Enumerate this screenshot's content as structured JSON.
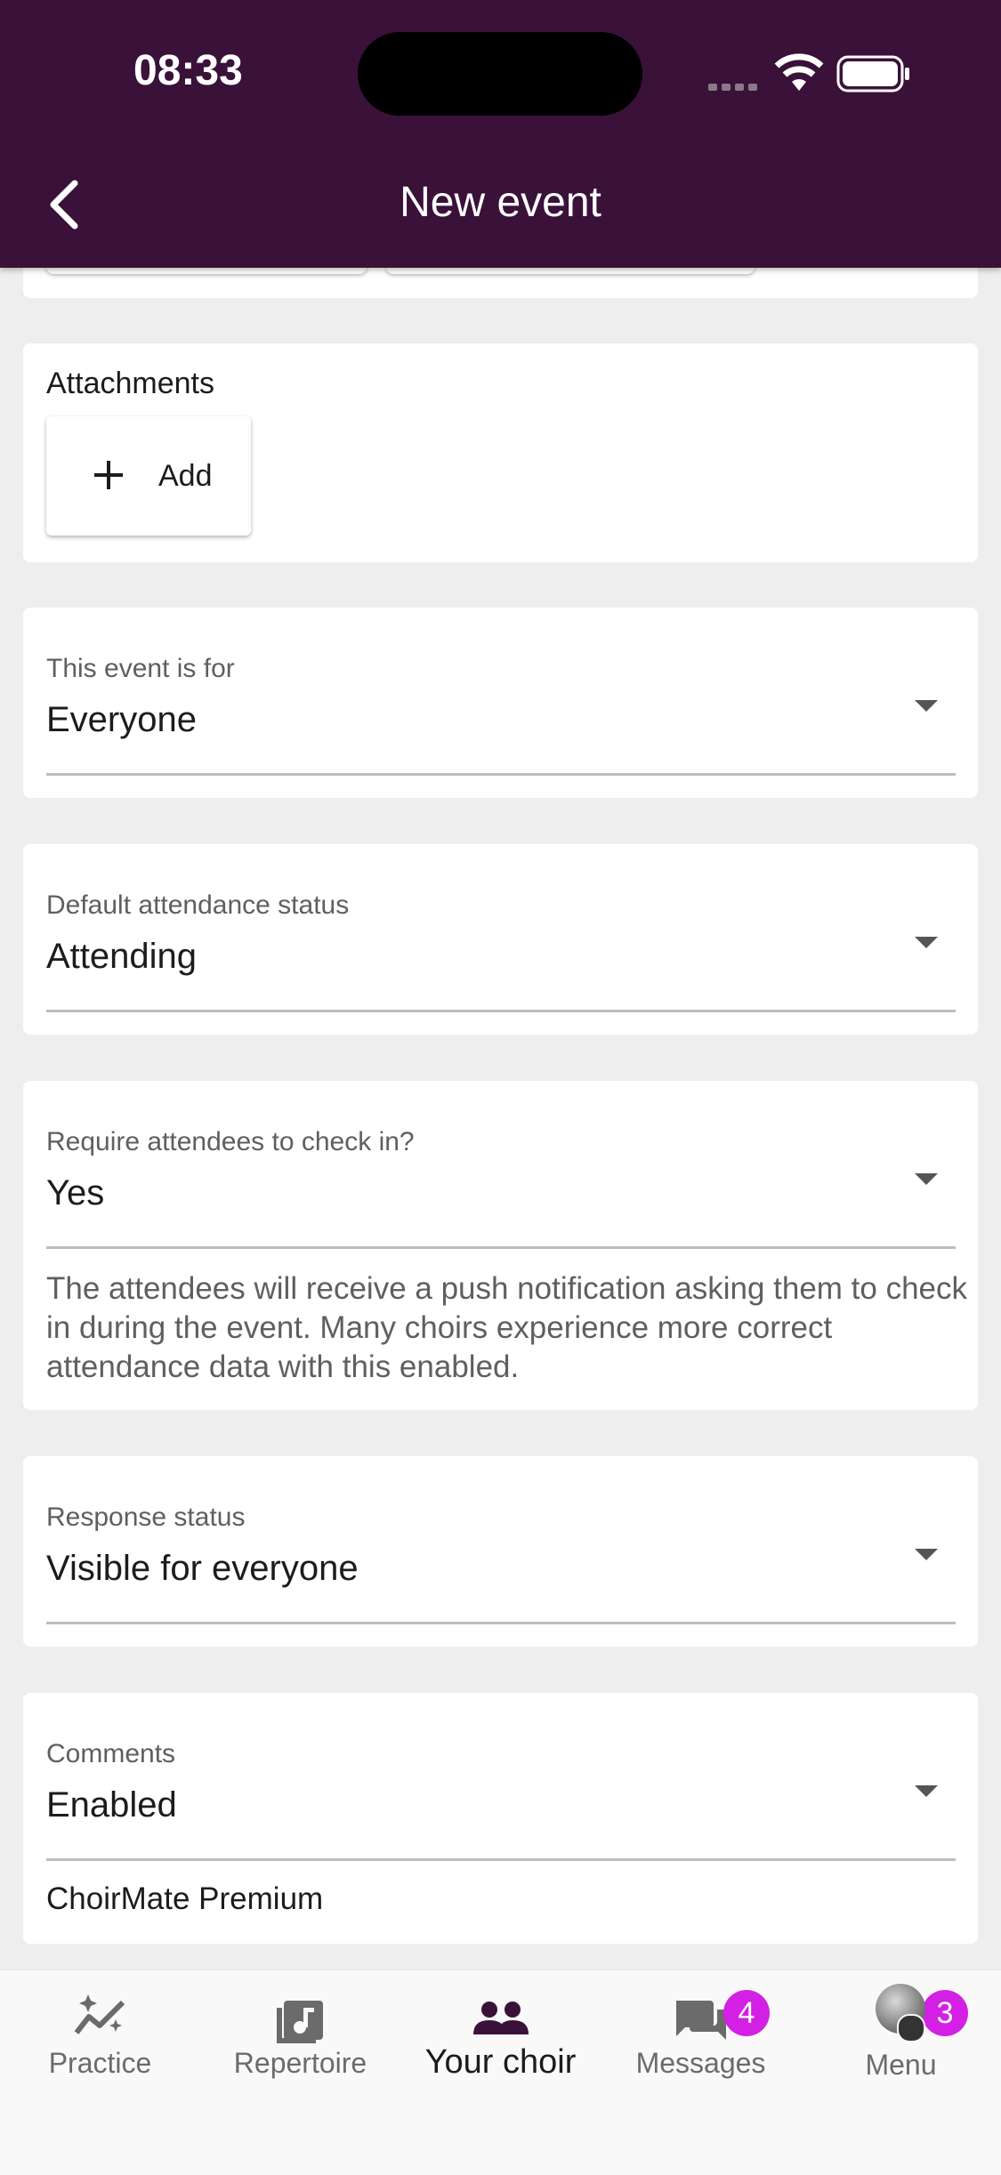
{
  "status_bar": {
    "time": "08:33"
  },
  "header": {
    "title": "New event"
  },
  "attachments": {
    "label": "Attachments",
    "add_label": "Add"
  },
  "event_for": {
    "label": "This event is for",
    "value": "Everyone"
  },
  "default_attendance": {
    "label": "Default attendance status",
    "value": "Attending"
  },
  "check_in": {
    "label": "Require attendees to check in?",
    "value": "Yes",
    "helper": "The attendees will receive a push notification asking them to check in during the event. Many choirs experience more correct attendance data with this enabled."
  },
  "response_status": {
    "label": "Response status",
    "value": "Visible for everyone"
  },
  "comments": {
    "label": "Comments",
    "value": "Enabled",
    "premium_note": "ChoirMate Premium"
  },
  "nav": {
    "items": [
      {
        "label": "Practice",
        "icon": "practice-icon"
      },
      {
        "label": "Repertoire",
        "icon": "music-note-icon"
      },
      {
        "label": "Your choir",
        "icon": "people-icon"
      },
      {
        "label": "Messages",
        "icon": "messages-icon",
        "badge": "4"
      },
      {
        "label": "Menu",
        "icon": "avatar",
        "badge": "3"
      }
    ]
  },
  "colors": {
    "header_bg": "#3a1139",
    "badge": "#d41fe4",
    "active_icon": "#3a1139"
  }
}
